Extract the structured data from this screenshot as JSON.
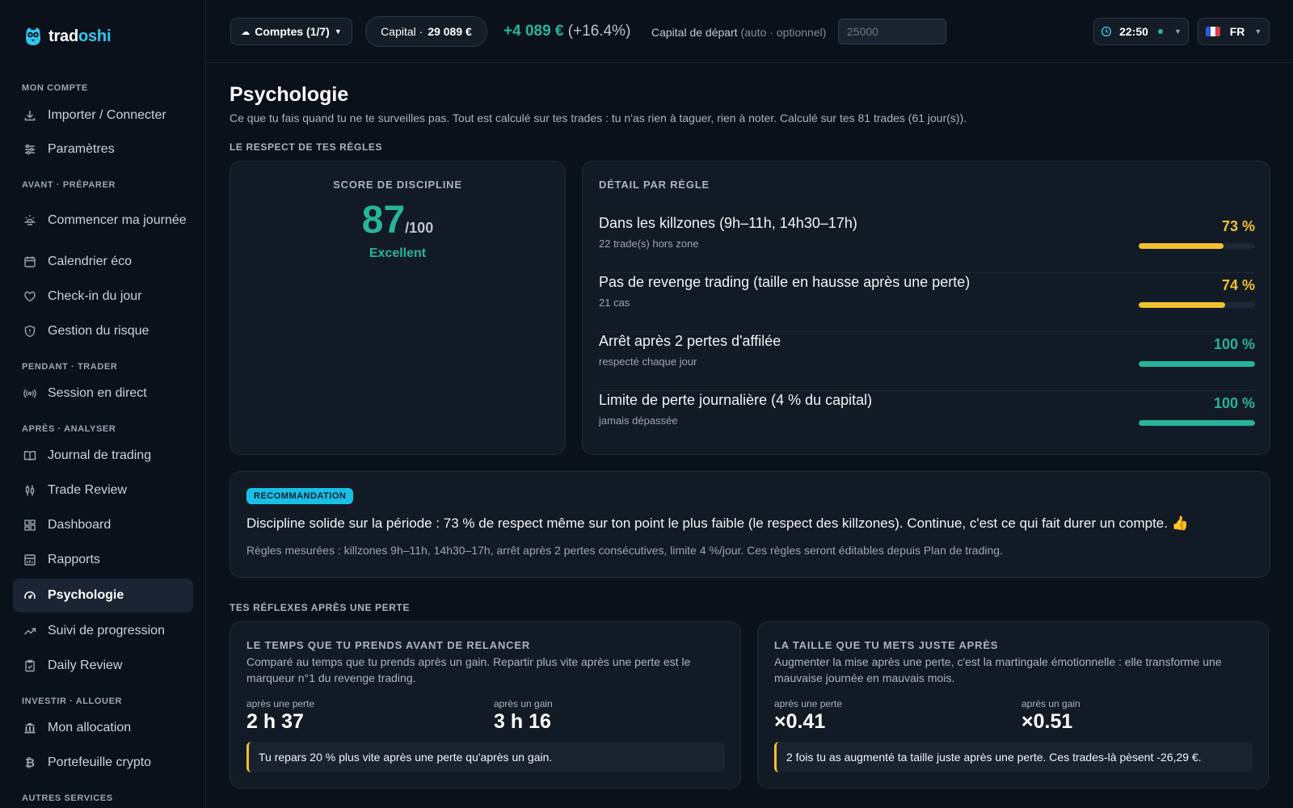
{
  "app": {
    "name_a": "trad",
    "name_b": "oshi"
  },
  "sidebar": {
    "sections": [
      {
        "label": "MON COMPTE"
      },
      {
        "label": "AVANT · PRÉPARER"
      },
      {
        "label": "PENDANT · TRADER"
      },
      {
        "label": "APRÈS · ANALYSER"
      },
      {
        "label": "INVESTIR · ALLOUER"
      },
      {
        "label": "AUTRES SERVICES"
      }
    ],
    "items": [
      {
        "label": "Importer / Connecter",
        "icon": "download-icon"
      },
      {
        "label": "Paramètres",
        "icon": "sliders-icon"
      },
      {
        "label": "Commencer ma journée",
        "icon": "sunrise-icon"
      },
      {
        "label": "Calendrier éco",
        "icon": "calendar-icon"
      },
      {
        "label": "Check-in du jour",
        "icon": "heart-icon"
      },
      {
        "label": "Gestion du risque",
        "icon": "shield-icon"
      },
      {
        "label": "Session en direct",
        "icon": "broadcast-icon"
      },
      {
        "label": "Journal de trading",
        "icon": "book-icon"
      },
      {
        "label": "Trade Review",
        "icon": "candles-icon"
      },
      {
        "label": "Dashboard",
        "icon": "grid-icon"
      },
      {
        "label": "Rapports",
        "icon": "report-icon"
      },
      {
        "label": "Psychologie",
        "icon": "gauge-icon",
        "active": true
      },
      {
        "label": "Suivi de progression",
        "icon": "trend-icon"
      },
      {
        "label": "Daily Review",
        "icon": "clipboard-icon"
      },
      {
        "label": "Mon allocation",
        "icon": "bank-icon"
      },
      {
        "label": "Portefeuille crypto",
        "icon": "bitcoin-icon"
      }
    ]
  },
  "topbar": {
    "accounts_label": "Comptes (1/7)",
    "capital_label": "Capital ·",
    "capital_value": "29 089 €",
    "gain_value": "+4 089 €",
    "gain_pct": "(+16.4%)",
    "start_capital_label": "Capital de départ",
    "start_capital_hint": "(auto · optionnel)",
    "start_capital_placeholder": "25000",
    "time": "22:50",
    "lang": "FR"
  },
  "page": {
    "title": "Psychologie",
    "subtitle": "Ce que tu fais quand tu ne te surveilles pas. Tout est calculé sur tes trades : tu n'as rien à taguer, rien à noter. Calculé sur tes 81 trades (61 jour(s))."
  },
  "rules_section": {
    "label": "LE RESPECT DE TES RÈGLES",
    "score": {
      "head": "SCORE DE DISCIPLINE",
      "value": "87",
      "denominator": "/100",
      "verdict": "Excellent"
    },
    "detail_head": "DÉTAIL PAR RÈGLE",
    "rules": [
      {
        "title": "Dans les killzones (9h–11h, 14h30–17h)",
        "sub": "22 trade(s) hors zone",
        "pct_label": "73 %",
        "pct": 73,
        "color": "#f2c12e"
      },
      {
        "title": "Pas de revenge trading (taille en hausse après une perte)",
        "sub": "21 cas",
        "pct_label": "74 %",
        "pct": 74,
        "color": "#f2c12e"
      },
      {
        "title": "Arrêt après 2 pertes d'affilée",
        "sub": "respecté chaque jour",
        "pct_label": "100 %",
        "pct": 100,
        "color": "#27b49a"
      },
      {
        "title": "Limite de perte journalière (4 % du capital)",
        "sub": "jamais dépassée",
        "pct_label": "100 %",
        "pct": 100,
        "color": "#27b49a"
      }
    ]
  },
  "recommendation": {
    "badge": "RECOMMANDATION",
    "text": "Discipline solide sur la période : 73 % de respect même sur ton point le plus faible (le respect des killzones). Continue, c'est ce qui fait durer un compte. 👍",
    "note": "Règles mesurées : killzones 9h–11h, 14h30–17h, arrêt après 2 pertes consécutives, limite 4 %/jour. Ces règles seront éditables depuis Plan de trading."
  },
  "reflexes": {
    "label": "TES RÉFLEXES APRÈS UNE PERTE",
    "cards": [
      {
        "head": "LE TEMPS QUE TU PRENDS AVANT DE RELANCER",
        "desc": "Comparé au temps que tu prends après un gain. Repartir plus vite après une perte est le marqueur n°1 du revenge trading.",
        "after_loss_label": "après une perte",
        "after_loss_value": "2 h 37",
        "after_gain_label": "après un gain",
        "after_gain_value": "3 h 16",
        "insight": "Tu repars 20 % plus vite après une perte qu'après un gain."
      },
      {
        "head": "LA TAILLE QUE TU METS JUSTE APRÈS",
        "desc": "Augmenter la mise après une perte, c'est la martingale émotionnelle : elle transforme une mauvaise journée en mauvais mois.",
        "after_loss_label": "après une perte",
        "after_loss_value": "×0.41",
        "after_gain_label": "après un gain",
        "after_gain_value": "×0.51",
        "insight": "2 fois tu as augmenté ta taille juste après une perte. Ces trades-là pèsent -26,29 €."
      }
    ]
  }
}
